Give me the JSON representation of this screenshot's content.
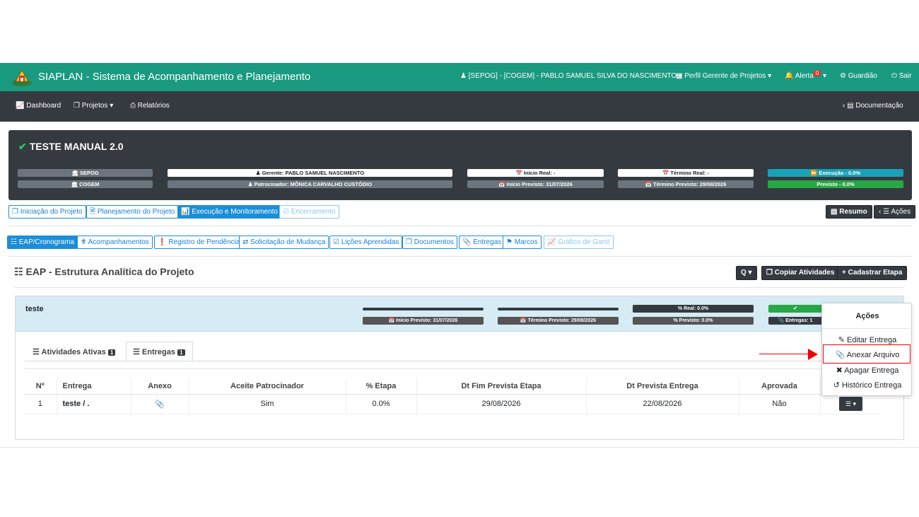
{
  "header": {
    "app_title": "SIAPLAN - Sistema de Acompanhamento e Planejamento",
    "user": "[SEPOG] - [COGEM] - PABLO SAMUEL SILVA DO NASCIMENTO",
    "profile": "Perfil Gerente de Projetos",
    "alert_label": "Alerta",
    "alert_count": "0",
    "guardiao": "Guardião",
    "sair": "Sair"
  },
  "nav": {
    "dashboard": "Dashboard",
    "projetos": "Projetos",
    "relatorios": "Relatórios",
    "documentacao": "Documentação"
  },
  "project": {
    "title": "TESTE MANUAL 2.0",
    "org1": "SEPOG",
    "org2": "COGEM",
    "gerente": "Gerente: PABLO SAMUEL NASCIMENTO",
    "patrocinador": "Patrocinador: MÔNICA CARVALHO CUSTÓDIO",
    "inicio_real": "Início Real: -",
    "inicio_previsto": "Início Previsto: 31/07/2026",
    "termino_real": "Término Real: -",
    "termino_previsto": "Término Previsto: 29/08/2026",
    "execucao": "Execução - 0.0%",
    "previsto": "Previsto - 0.0%"
  },
  "phase_tabs": {
    "iniciacao": "Iniciação do Projeto",
    "planejamento": "Planejamento do Projeto",
    "execucao": "Execução e Monitoramento",
    "encerramento": "Encerramento",
    "resumo": "Resumo",
    "acoes": "Ações"
  },
  "sub_tabs": {
    "eap": "EAP/Cronograma",
    "acompanhamentos": "Acompanhamentos",
    "pendencias": "Registro de Pendências",
    "mudanca": "Solicitação de Mudança",
    "licoes": "Lições Aprendidas",
    "documentos": "Documentos",
    "entregas": "Entregas",
    "marcos": "Marcos",
    "gantt": "Gráfico de Gantt"
  },
  "eap": {
    "title": "EAP - Estrutura Analítica do Projeto",
    "search_label": "Q",
    "copiar": "Copiar Atividades",
    "cadastrar": "Cadastrar Etapa"
  },
  "stage": {
    "name": "teste",
    "inicio_previsto": "Início Previsto: 31/07/2026",
    "termino_previsto": "Término Previsto: 29/08/2026",
    "real": "% Real: 0.0%",
    "previsto": "% Previsto: 0.0%",
    "entregas": "Entregas: 1",
    "tab_atividades": "Atividades Ativas",
    "tab_atividades_count": "1",
    "tab_entregas": "Entregas",
    "tab_entregas_count": "1"
  },
  "table": {
    "headers": [
      "Nº",
      "Entrega",
      "Anexo",
      "Aceite Patrocinador",
      "% Etapa",
      "Dt Fim Prevista Etapa",
      "Dt Prevista Entrega",
      "Aprovada"
    ],
    "rows": [
      {
        "n": "1",
        "entrega": "teste / .",
        "aceite": "Sim",
        "etapa": "0.0%",
        "dt_fim": "29/08/2026",
        "dt_entrega": "22/08/2026",
        "aprovada": "Não"
      }
    ]
  },
  "menu": {
    "title": "Ações",
    "editar": "Editar Entrega",
    "anexar": "Anexar Arquivo",
    "apagar": "Apagar Entrega",
    "historico": "Histórico Entrega"
  },
  "colors": {
    "topbar": "#1a9a80",
    "navbar": "#343a40",
    "primary": "#1b8ed8",
    "highlight": "#ee0000"
  }
}
